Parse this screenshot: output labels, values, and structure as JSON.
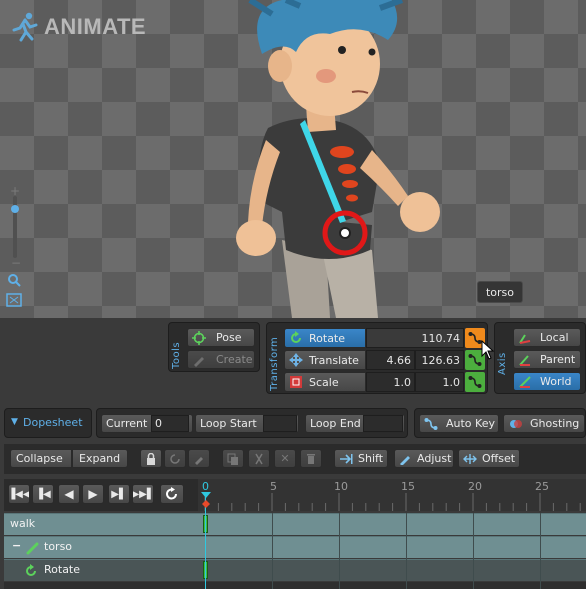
{
  "app": {
    "title": "ANIMATE"
  },
  "viewport": {
    "bone_label": "torso"
  },
  "tools": {
    "title": "Tools",
    "pose_label": "Pose",
    "create_label": "Create"
  },
  "transform": {
    "title": "Transform",
    "rows": [
      {
        "label": "Rotate",
        "value1": "",
        "value2": "110.74"
      },
      {
        "label": "Translate",
        "value1": "4.66",
        "value2": "126.63"
      },
      {
        "label": "Scale",
        "value1": "1.0",
        "value2": "1.0"
      }
    ]
  },
  "axis": {
    "title": "Axis",
    "options": [
      "Local",
      "Parent",
      "World"
    ],
    "selected": "World"
  },
  "dopesheet": {
    "title": "Dopesheet",
    "current_label": "Current",
    "current_value": "0",
    "loop_start_label": "Loop Start",
    "loop_end_label": "Loop End",
    "auto_key_label": "Auto Key",
    "ghosting_label": "Ghosting",
    "collapse_label": "Collapse",
    "expand_label": "Expand",
    "shift_label": "Shift",
    "adjust_label": "Adjust",
    "offset_label": "Offset"
  },
  "timeline": {
    "ticks": [
      "0",
      "5",
      "10",
      "15",
      "20",
      "25"
    ],
    "tracks": [
      {
        "label": "walk"
      },
      {
        "label": "torso"
      },
      {
        "label": "Rotate"
      }
    ]
  }
}
